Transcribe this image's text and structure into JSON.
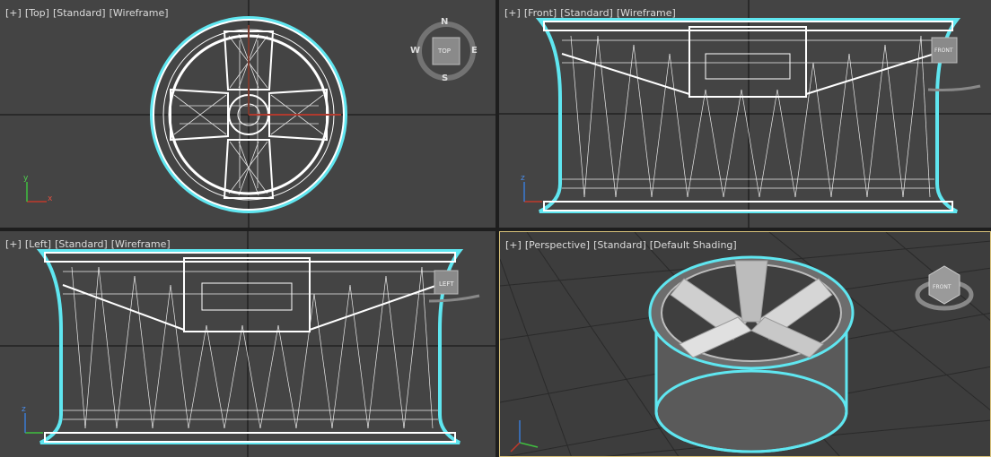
{
  "viewports": [
    {
      "id": "top",
      "plus": "[+]",
      "view": "[Top]",
      "mode": "[Standard]",
      "shading": "[Wireframe]",
      "viewcube": "TOP"
    },
    {
      "id": "front",
      "plus": "[+]",
      "view": "[Front]",
      "mode": "[Standard]",
      "shading": "[Wireframe]",
      "viewcube": "FRONT"
    },
    {
      "id": "left",
      "plus": "[+]",
      "view": "[Left]",
      "mode": "[Standard]",
      "shading": "[Wireframe]",
      "viewcube": "LEFT"
    },
    {
      "id": "perspective",
      "plus": "[+]",
      "view": "[Perspective]",
      "mode": "[Standard]",
      "shading": "[Default Shading]",
      "viewcube": "FRONT"
    }
  ],
  "compass": {
    "n": "N",
    "s": "S",
    "e": "E",
    "w": "W"
  },
  "axes": {
    "x": "x",
    "y": "y",
    "z": "z"
  },
  "colors": {
    "viewport_bg": "#444444",
    "wire": "#ffffff",
    "selection": "#5fe6f0",
    "grid_dark": "#000000",
    "active_border": "#d8c27a"
  }
}
